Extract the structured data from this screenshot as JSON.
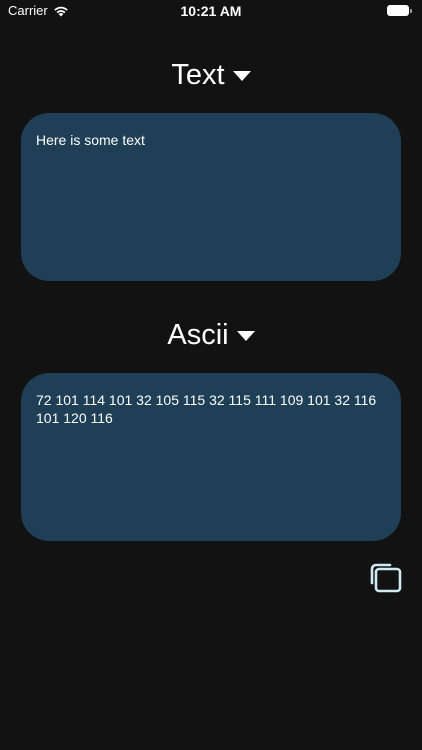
{
  "status_bar": {
    "carrier": "Carrier",
    "time": "10:21 AM"
  },
  "source": {
    "format_label": "Text",
    "value": "Here is some text"
  },
  "target": {
    "format_label": "Ascii",
    "value": "72 101 114 101 32 105 115 32 115 111 109 101 32 116 101 120 116"
  },
  "icons": {
    "wifi": "wifi-icon",
    "battery": "battery-icon",
    "caret": "caret-down-icon",
    "copy": "copy-icon"
  },
  "colors": {
    "background": "#121212",
    "box": "#1e3f55",
    "text": "#ffffff",
    "copy_icon": "#cfeaf3"
  }
}
